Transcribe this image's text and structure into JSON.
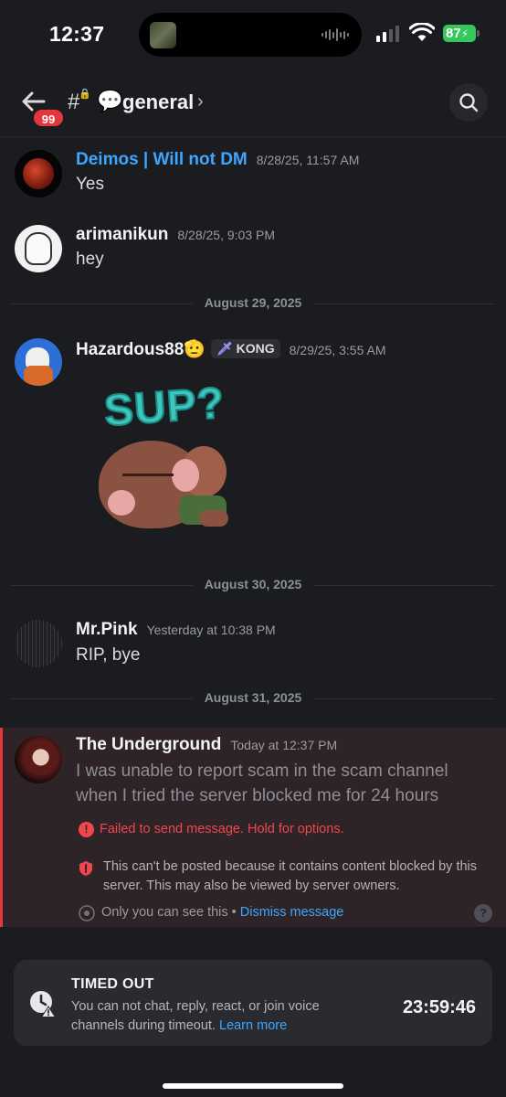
{
  "status_bar": {
    "time": "12:37",
    "battery": "87"
  },
  "header": {
    "badge": "99",
    "channel_emoji": "💬",
    "channel_name": "general"
  },
  "messages": [
    {
      "author": "Deimos | Will not DM",
      "author_color": "#3ea6ff",
      "timestamp": "8/28/25, 11:57 AM",
      "text": "Yes"
    },
    {
      "author": "arimanikun",
      "timestamp": "8/28/25, 9:03 PM",
      "text": "hey"
    },
    {
      "author": "Hazardous88",
      "author_emoji": "🫡",
      "role_tag": "KONG",
      "timestamp": "8/29/25, 3:55 AM",
      "sticker_text": "SUP?"
    },
    {
      "author": "Mr.Pink",
      "timestamp": "Yesterday at 10:38 PM",
      "text": "RIP, bye"
    },
    {
      "author": "The Underground",
      "timestamp": "Today at 12:37 PM",
      "text": "I was unable to report scam in the scam channel when I tried the server blocked me for 24 hours"
    }
  ],
  "dividers": [
    "August 29, 2025",
    "August 30, 2025",
    "August 31, 2025"
  ],
  "failed": {
    "error": "Failed to send message. Hold for options.",
    "blocked": "This can't be posted because it contains content blocked by this server. This may also be viewed by server owners.",
    "ephemeral": "Only you can see this •",
    "dismiss": "Dismiss message"
  },
  "timeout": {
    "title": "TIMED OUT",
    "description": "You can not chat, reply, react, or join voice channels during timeout.",
    "learn_more": "Learn more",
    "timer": "23:59:46"
  }
}
